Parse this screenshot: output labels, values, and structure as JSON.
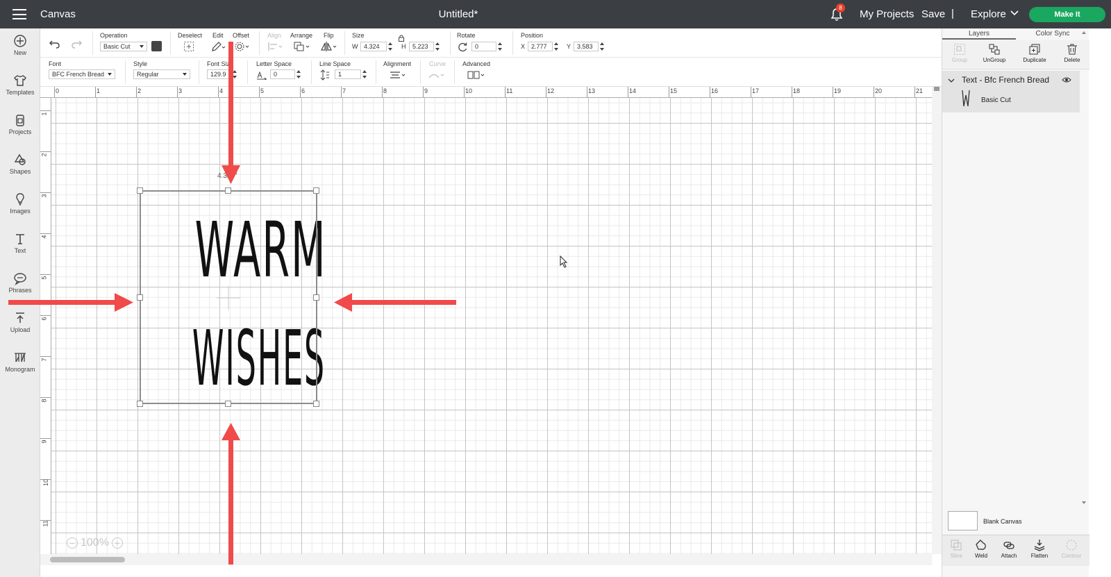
{
  "header": {
    "app_name": "Canvas",
    "doc_title": "Untitled*",
    "notification_count": "8",
    "my_projects": "My Projects",
    "save": "Save",
    "separator": "|",
    "explore": "Explore",
    "make_it": "Make It"
  },
  "sidebar": {
    "items": [
      {
        "label": "New",
        "icon": "plus-circle-icon"
      },
      {
        "label": "Templates",
        "icon": "shirt-icon"
      },
      {
        "label": "Projects",
        "icon": "clipboard-icon"
      },
      {
        "label": "Shapes",
        "icon": "shapes-icon"
      },
      {
        "label": "Images",
        "icon": "lightbulb-icon"
      },
      {
        "label": "Text",
        "icon": "text-icon"
      },
      {
        "label": "Phrases",
        "icon": "speech-bubble-icon"
      },
      {
        "label": "Upload",
        "icon": "upload-icon"
      },
      {
        "label": "Monogram",
        "icon": "monogram-icon"
      }
    ]
  },
  "toolbar": {
    "operation_label": "Operation",
    "operation_value": "Basic Cut",
    "deselect_label": "Deselect",
    "edit_label": "Edit",
    "offset_label": "Offset",
    "align_label": "Align",
    "arrange_label": "Arrange",
    "flip_label": "Flip",
    "size_label": "Size",
    "w_label": "W",
    "w_value": "4.324",
    "h_label": "H",
    "h_value": "5.223",
    "rotate_label": "Rotate",
    "rotate_value": "0",
    "position_label": "Position",
    "x_label": "X",
    "x_value": "2.777",
    "y_label": "Y",
    "y_value": "3.583"
  },
  "text_toolbar": {
    "font_label": "Font",
    "font_value": "BFC French Bread",
    "style_label": "Style",
    "style_value": "Regular",
    "font_size_label": "Font Size",
    "font_size_value": "129.9",
    "letter_space_label": "Letter Space",
    "letter_space_value": "0",
    "line_space_label": "Line Space",
    "line_space_value": "1",
    "alignment_label": "Alignment",
    "curve_label": "Curve",
    "advanced_label": "Advanced"
  },
  "rulers": {
    "top": [
      "0",
      "1",
      "2",
      "3",
      "4",
      "5",
      "6",
      "7",
      "8",
      "9",
      "10",
      "11",
      "12",
      "13",
      "14",
      "15",
      "16",
      "17",
      "18",
      "19",
      "20",
      "21"
    ],
    "left": [
      "1",
      "2",
      "3",
      "4",
      "5",
      "6",
      "7",
      "8",
      "9",
      "10",
      "11"
    ]
  },
  "canvas": {
    "line1": "WARM",
    "line2": "WISHES",
    "dimension_label": "4.324\"",
    "zoom_value": "100%"
  },
  "panel": {
    "tabs": [
      "Layers",
      "Color Sync"
    ],
    "tools": [
      {
        "label": "Group",
        "enabled": false
      },
      {
        "label": "UnGroup",
        "enabled": true
      },
      {
        "label": "Duplicate",
        "enabled": true
      },
      {
        "label": "Delete",
        "enabled": true
      }
    ],
    "layer_group_title": "Text - Bfc French Bread",
    "layer_item_label": "Basic Cut",
    "blank_canvas": "Blank Canvas",
    "bottom_tools": [
      {
        "label": "Slice",
        "enabled": false
      },
      {
        "label": "Weld",
        "enabled": true
      },
      {
        "label": "Attach",
        "enabled": true
      },
      {
        "label": "Flatten",
        "enabled": true
      },
      {
        "label": "Contour",
        "enabled": false
      }
    ]
  },
  "colors": {
    "header_bg": "#3b3f44",
    "make_it_green": "#1aa760",
    "annotation_red": "#f04a4a",
    "layer_swatch": "#444444"
  }
}
